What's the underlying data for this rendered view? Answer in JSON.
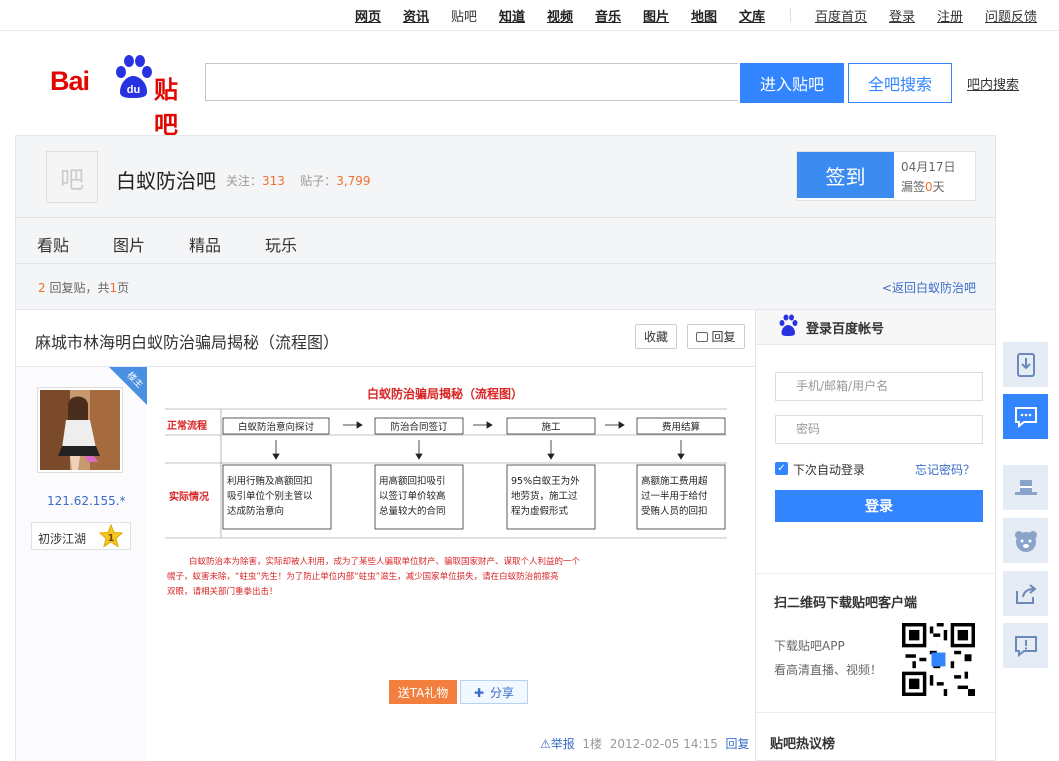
{
  "topnav": {
    "links": [
      "网页",
      "资讯",
      "贴吧",
      "知道",
      "视频",
      "音乐",
      "图片",
      "地图",
      "文库"
    ],
    "right_links": [
      "百度首页",
      "登录",
      "注册",
      "问题反馈"
    ]
  },
  "logo": {
    "text_bai": "Bai",
    "text_du": "du",
    "text_tieba": "贴吧"
  },
  "search": {
    "placeholder": "",
    "enter_label": "进入贴吧",
    "all_label": "全吧搜索",
    "inbar_label": "吧内搜索"
  },
  "forum": {
    "avatar_text": "吧",
    "name": "白蚁防治吧",
    "follow_label": "关注：",
    "follow_count": "313",
    "posts_label": "贴子：",
    "posts_count": "3,799",
    "sign_label": "签到",
    "sign_date": "04月17日",
    "miss_prefix": "漏签",
    "miss_count": "0",
    "miss_suffix": "天"
  },
  "tabs": [
    "看贴",
    "图片",
    "精品",
    "玩乐"
  ],
  "thread_info": {
    "reply_num": "2",
    "reply_text": "回复贴，共",
    "page_num": "1",
    "page_suffix": "页",
    "back_label": "<返回白蚁防治吧"
  },
  "thread": {
    "title": "麻城市林海明白蚁防治骗局揭秘（流程图）",
    "fav_label": "收藏",
    "reply_label": "回复"
  },
  "post": {
    "ribbon": "楼主",
    "user_ip": "121.62.155.*",
    "level_name": "初涉江湖",
    "level_num": "1",
    "gift_label": "送TA礼物",
    "share_label": "分享",
    "report_label": "举报",
    "floor": "1楼",
    "time": "2012-02-05 14:15",
    "reply_label": "回复"
  },
  "flowchart": {
    "title": "白蚁防治骗局揭秘（流程图）",
    "row1_label": "正常流程",
    "steps": [
      "白蚁防治意向探讨",
      "防治合同签订",
      "施工",
      "费用结算"
    ],
    "row2_label": "实际情况",
    "boxes": [
      [
        "利用行贿及高额回扣",
        "吸引单位个别主管以",
        "达成防治意向"
      ],
      [
        "用高额回扣吸引",
        "以签订单价较高",
        "总量较大的合同"
      ],
      [
        "95%白蚁王为外",
        "地劳货，施工过",
        "程为虚假形式"
      ],
      [
        "高额施工费用超",
        "过一半用于给付",
        "受贿人员的回扣"
      ]
    ],
    "note_lines": [
      "白蚁防治本为除害，实际却被人利用，成为了某些人骗取单位财产、骗取国家财产、谋取个人利益的一个",
      "幌子，蚁害未除，“蛀虫”先生！为了防止单位内部“蛀虫”滋生，减少国家单位损失，请在白蚁防治前擦亮",
      "双眼，请相关部门重拳出击！"
    ]
  },
  "login": {
    "title": "登录百度帐号",
    "user_placeholder": "手机/邮箱/用户名",
    "pwd_placeholder": "密码",
    "auto_label": "下次自动登录",
    "forgot_label": "忘记密码？",
    "login_label": "登录"
  },
  "qr": {
    "title": "扫二维码下载贴吧客户端",
    "line1": "下载贴吧APP",
    "line2": "看高清直播、视频！"
  },
  "hot": {
    "title": "贴吧热议榜"
  },
  "colors": {
    "brand_blue": "#3385ff",
    "logo_red": "#e10601",
    "accent_orange": "#f0712c",
    "link_blue": "#3a6cc8"
  }
}
